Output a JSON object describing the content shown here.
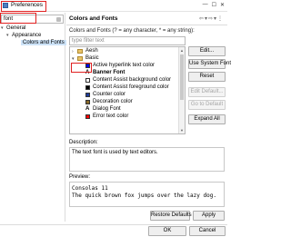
{
  "window": {
    "title": "Preferences"
  },
  "sidebar": {
    "filter_value": "font",
    "tree": [
      {
        "label": "General",
        "level": 0,
        "expanded": true
      },
      {
        "label": "Appearance",
        "level": 1,
        "expanded": true
      },
      {
        "label": "Colors and Fonts",
        "level": 2,
        "selected": true
      }
    ]
  },
  "page": {
    "title": "Colors and Fonts",
    "nav_icons": [
      "back-arrow",
      "forward-arrow",
      "menu-caret"
    ],
    "subtitle": "Colors and Fonts (? = any character, * = any string):",
    "filter_placeholder": "type filter text",
    "list": [
      {
        "label": "Aesh",
        "type": "category",
        "expanded": false,
        "indent": 0
      },
      {
        "label": "Basic",
        "type": "category",
        "expanded": true,
        "indent": 0
      },
      {
        "label": "Active hyperlink text color",
        "type": "color",
        "color": "#0000ff",
        "indent": 1
      },
      {
        "label": "Banner Font",
        "type": "font",
        "indent": 1
      },
      {
        "label": "Content Assist background color",
        "type": "color",
        "color": "#ffffff",
        "indent": 1
      },
      {
        "label": "Content Assist foreground color",
        "type": "color",
        "color": "#000000",
        "indent": 1
      },
      {
        "label": "Counter color",
        "type": "color",
        "color": "#1c3b9b",
        "indent": 1
      },
      {
        "label": "Decoration color",
        "type": "color",
        "color": "#8a6a2a",
        "indent": 1
      },
      {
        "label": "Dialog Font",
        "type": "font",
        "indent": 1
      },
      {
        "label": "Error text color",
        "type": "color",
        "color": "#ff0000",
        "indent": 1
      }
    ],
    "buttons": {
      "edit": "Edit...",
      "use_system_font": "Use System Font",
      "reset": "Reset",
      "edit_default": "Edit Default...",
      "go_to_default": "Go to Default",
      "expand_all": "Expand All"
    },
    "description_label": "Description:",
    "description_text": "The text font is used by text editors.",
    "preview_label": "Preview:",
    "preview_line1": "Consolas 11",
    "preview_line2": "The quick brown fox jumps over the lazy dog.",
    "restore_defaults": "Restore Defaults",
    "apply": "Apply"
  },
  "footer": {
    "ok": "OK",
    "cancel": "Cancel"
  }
}
